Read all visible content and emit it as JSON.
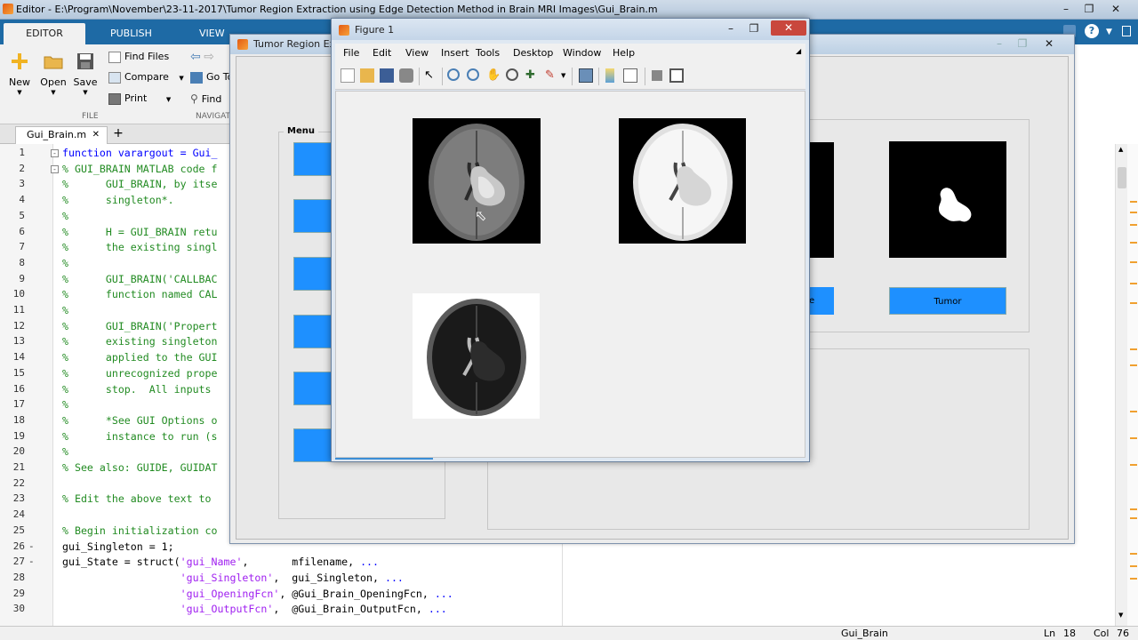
{
  "editor": {
    "title": "Editor - E:\\Program\\November\\23-11-2017\\Tumor Region Extraction using Edge Detection Method in Brain MRI Images\\Gui_Brain.m",
    "tabs": [
      "EDITOR",
      "PUBLISH",
      "VIEW"
    ],
    "ribbon": {
      "new": "New",
      "open": "Open",
      "save": "Save",
      "find_files": "Find Files",
      "compare": "Compare",
      "print": "Print",
      "go_to": "Go To",
      "find": "Find",
      "group_file": "FILE",
      "group_navigate": "NAVIGAT"
    },
    "file_tab": "Gui_Brain.m",
    "code_lines": [
      {
        "n": "1",
        "dash": "",
        "fold": "-",
        "text": "function varargout = Gui_"
      },
      {
        "n": "2",
        "dash": "",
        "fold": "-",
        "text": "% GUI_BRAIN MATLAB code f"
      },
      {
        "n": "3",
        "dash": "",
        "fold": "",
        "text": "%      GUI_BRAIN, by itse"
      },
      {
        "n": "4",
        "dash": "",
        "fold": "",
        "text": "%      singleton*."
      },
      {
        "n": "5",
        "dash": "",
        "fold": "",
        "text": "%"
      },
      {
        "n": "6",
        "dash": "",
        "fold": "",
        "text": "%      H = GUI_BRAIN retu"
      },
      {
        "n": "7",
        "dash": "",
        "fold": "",
        "text": "%      the existing singl"
      },
      {
        "n": "8",
        "dash": "",
        "fold": "",
        "text": "%"
      },
      {
        "n": "9",
        "dash": "",
        "fold": "",
        "text": "%      GUI_BRAIN('CALLBAC"
      },
      {
        "n": "10",
        "dash": "",
        "fold": "",
        "text": "%      function named CAL"
      },
      {
        "n": "11",
        "dash": "",
        "fold": "",
        "text": "%"
      },
      {
        "n": "12",
        "dash": "",
        "fold": "",
        "text": "%      GUI_BRAIN('Propert"
      },
      {
        "n": "13",
        "dash": "",
        "fold": "",
        "text": "%      existing singleton"
      },
      {
        "n": "14",
        "dash": "",
        "fold": "",
        "text": "%      applied to the GUI"
      },
      {
        "n": "15",
        "dash": "",
        "fold": "",
        "text": "%      unrecognized prope"
      },
      {
        "n": "16",
        "dash": "",
        "fold": "",
        "text": "%      stop.  All inputs"
      },
      {
        "n": "17",
        "dash": "",
        "fold": "",
        "text": "%"
      },
      {
        "n": "18",
        "dash": "",
        "fold": "",
        "text": "%      *See GUI Options o"
      },
      {
        "n": "19",
        "dash": "",
        "fold": "",
        "text": "%      instance to run (s"
      },
      {
        "n": "20",
        "dash": "",
        "fold": "",
        "text": "%"
      },
      {
        "n": "21",
        "dash": "",
        "fold": "",
        "text": "% See also: GUIDE, GUIDAT"
      },
      {
        "n": "22",
        "dash": "",
        "fold": "",
        "text": ""
      },
      {
        "n": "23",
        "dash": "",
        "fold": "",
        "text": "% Edit the above text to"
      },
      {
        "n": "24",
        "dash": "",
        "fold": "",
        "text": ""
      },
      {
        "n": "25",
        "dash": "",
        "fold": "",
        "text": "% Begin initialization co"
      },
      {
        "n": "26",
        "dash": "-",
        "fold": "",
        "text": "gui_Singleton = 1;"
      },
      {
        "n": "27",
        "dash": "-",
        "fold": "",
        "text": "gui_State = struct('gui_Name',       mfilename, ..."
      },
      {
        "n": "28",
        "dash": "",
        "fold": "",
        "text": "                   'gui_Singleton',  gui_Singleton, ..."
      },
      {
        "n": "29",
        "dash": "",
        "fold": "",
        "text": "                   'gui_OpeningFcn', @Gui_Brain_OpeningFcn, ..."
      },
      {
        "n": "30",
        "dash": "",
        "fold": "",
        "text": "                   'gui_OutputFcn',  @Gui_Brain_OutputFcn, ..."
      }
    ],
    "status": {
      "file": "Gui_Brain",
      "ln_label": "Ln",
      "ln": "18",
      "col_label": "Col",
      "col": "76"
    }
  },
  "gui": {
    "title": "Tumor Region Ex",
    "menu_label": "Menu",
    "button_partial": "e",
    "tumor_button": "Tumor"
  },
  "figure": {
    "title": "Figure 1",
    "menus": [
      "File",
      "Edit",
      "View",
      "Insert",
      "Tools",
      "Desktop",
      "Window",
      "Help"
    ],
    "toolbar_icons": [
      "new-figure-icon",
      "open-file-icon",
      "save-figure-icon",
      "print-figure-icon",
      "edit-plot-icon",
      "zoom-in-icon",
      "zoom-out-icon",
      "pan-icon",
      "rotate-3d-icon",
      "data-cursor-icon",
      "brush-icon",
      "link-plot-icon",
      "insert-colorbar-icon",
      "insert-legend-icon",
      "hide-plot-tools-icon",
      "show-plot-tools-icon"
    ]
  },
  "colors": {
    "matlab_blue": "#1e6aa5",
    "gui_button_blue": "#1e90ff",
    "comment_green": "#228b22",
    "keyword_blue": "#0000ff",
    "string_purple": "#a020f0"
  }
}
